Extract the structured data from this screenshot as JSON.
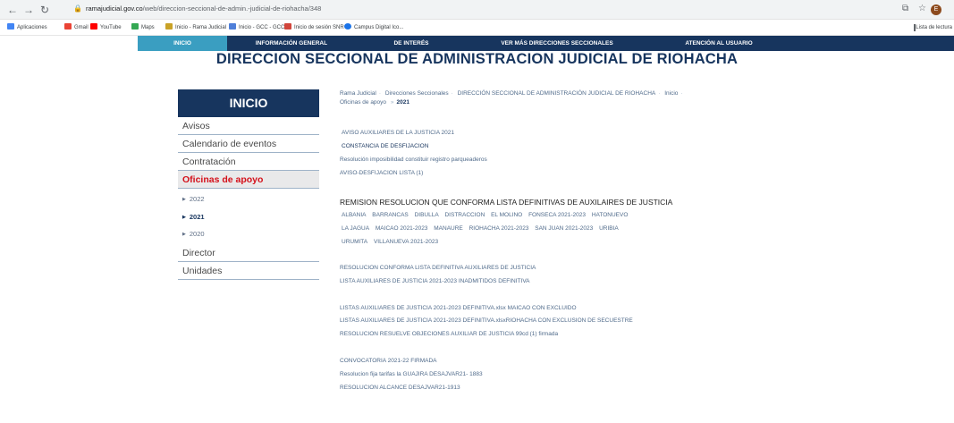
{
  "browser": {
    "url_host": "ramajudicial.gov.co",
    "url_path": "/web/direccion-seccional-de-admin.-judicial-de-riohacha/348",
    "avatar_letter": "E",
    "bookmarks": [
      "Aplicaciones",
      "Gmail",
      "YouTube",
      "Maps",
      "Inicio - Rama Judicial",
      "Inicio - GCC - GCC",
      "Inicio de sesión SNR",
      "Campus Digital Ico..."
    ],
    "reading_list": "Lista de lectura",
    "colors": {
      "chrome": "#f1f3f4"
    }
  },
  "sitenav": {
    "items": [
      "INICIO",
      "INFORMACIÓN GENERAL",
      "DE INTERÉS",
      "VER MÁS DIRECCIONES SECCIONALES",
      "ATENCIÓN AL USUARIO"
    ],
    "active_index": 0,
    "colors": {
      "bar": "#17355e",
      "active": "#3a9ec1"
    }
  },
  "page_title": "DIRECCION SECCIONAL DE ADMINISTRACION JUDICIAL DE RIOHACHA",
  "sidebar": {
    "header": "INICIO",
    "items": [
      "Avisos",
      "Calendario de eventos",
      "Contratación",
      "Oficinas de apoyo"
    ],
    "active": "Oficinas de apoyo",
    "subitems": [
      "2022",
      "2021",
      "2020"
    ],
    "active_subitem": "2021",
    "items_after": [
      "Director",
      "Unidades"
    ]
  },
  "breadcrumb": {
    "items": [
      "Rama Judicial",
      "Direcciones Seccionales",
      "DIRECCIÓN SECCIONAL DE ADMINISTRACIÓN JUDICIAL DE RIOHACHA",
      "Inicio",
      "Oficinas de apoyo"
    ],
    "current": "2021"
  },
  "content": {
    "links_group1": [
      "AVISO AUXILIARES DE LA JUSTICIA 2021",
      "CONSTANCIA DE DESFIJACION",
      "Resolución imposibilidad constituir registro parqueaderos",
      "AVISO-DESFIJACION LISTA (1)"
    ],
    "heading": "REMISION RESOLUCION QUE CONFORMA LISTA DEFINITIVAS DE AUXILAIRES DE JUSTICIA",
    "towns_line1": [
      "ALBANIA",
      "BARRANCAS",
      "DIBULLA",
      "DISTRACCION",
      "EL MOLINO",
      "FONSECA 2021-2023",
      "HATONUEVO"
    ],
    "towns_line2": [
      "LA JAGUA",
      "MAICAO 2021-2023",
      "MANAURE",
      "RIOHACHA 2021-2023",
      "SAN JUAN 2021-2023",
      "URIBIA"
    ],
    "towns_line3": [
      "URUMITA",
      "VILLANUEVA 2021-2023"
    ],
    "links_group2": [
      "RESOLUCION CONFORMA LISTA DEFINITIVA AUXILIARES DE JUSTICIA",
      "LISTA AUXILIARES DE JUSTICIA 2021-2023 INADMITIDOS DEFINITIVA"
    ],
    "links_group3": [
      "LISTAS AUXILIARES DE JUSTICIA 2021-2023 DEFINITIVA.xlsx MAICAO CON EXCLUIDO",
      "LISTAS AUXILIARES DE JUSTICIA 2021-2023 DEFINITIVA.xlsxRIOHACHA CON EXCLUSION DE SECUESTRE",
      "RESOLUCION RESUELVE OBJECIONES AUXILIAR DE JUSTICIA 99cd (1) firmada"
    ],
    "links_group4": [
      "CONVOCATORIA 2021-22 FIRMADA",
      "Resolucion fija tarifas la GUAJIRA DESAJVAR21- 1883",
      "RESOLUCION ALCANCE DESAJVAR21-1913"
    ]
  }
}
